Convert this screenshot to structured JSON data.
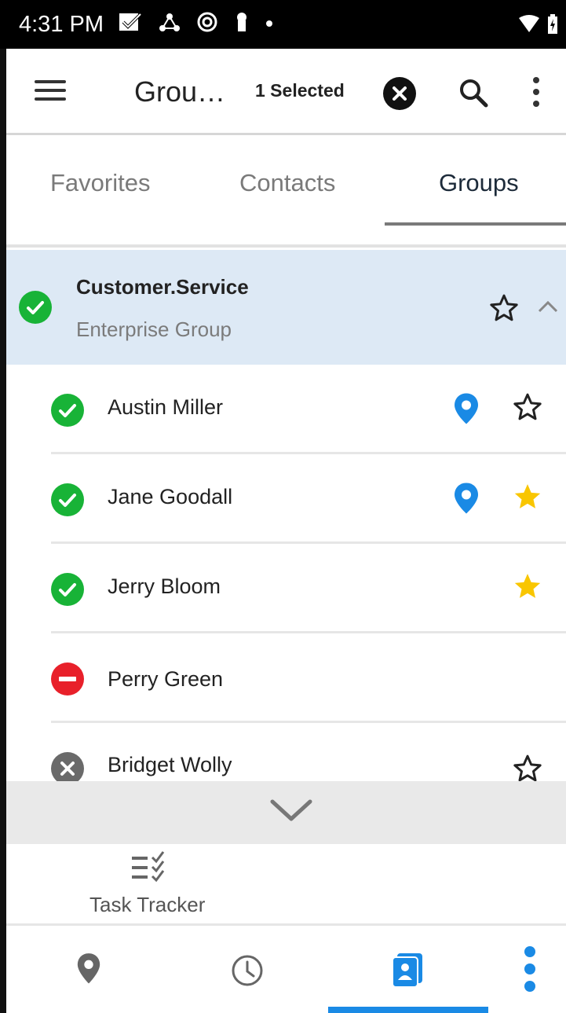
{
  "status_bar": {
    "time": "4:31 PM"
  },
  "app_bar": {
    "title": "Grou…",
    "selection_text": "1 Selected"
  },
  "tabs": [
    {
      "label": "Favorites",
      "active": false
    },
    {
      "label": "Contacts",
      "active": false
    },
    {
      "label": "Groups",
      "active": true
    }
  ],
  "group": {
    "name": "Customer.Service",
    "subtitle": "Enterprise Group",
    "status": "available",
    "favorite": false,
    "expanded": true
  },
  "contacts": [
    {
      "name": "Austin Miller",
      "status": "available",
      "has_location": true,
      "favorite": false
    },
    {
      "name": "Jane Goodall",
      "status": "available",
      "has_location": true,
      "favorite": true
    },
    {
      "name": "Jerry Bloom",
      "status": "available",
      "has_location": false,
      "favorite": true
    },
    {
      "name": "Perry Green",
      "status": "do-not-disturb",
      "has_location": false,
      "favorite": null
    },
    {
      "name": "Bridget Wolly",
      "status": "offline",
      "has_location": false,
      "favorite": false
    }
  ],
  "task_tracker": {
    "label": "Task Tracker"
  },
  "bottom_nav": {
    "items": [
      "map-icon",
      "history-icon",
      "contacts-icon",
      "more-icon"
    ],
    "active_index": 2
  },
  "colors": {
    "available": "#18b337",
    "dnd": "#e8202a",
    "offline": "#6a6a6a",
    "location": "#1a8ae5",
    "favorite": "#f9c600",
    "accent": "#1a8ae5",
    "group_bg": "#dde9f5"
  }
}
